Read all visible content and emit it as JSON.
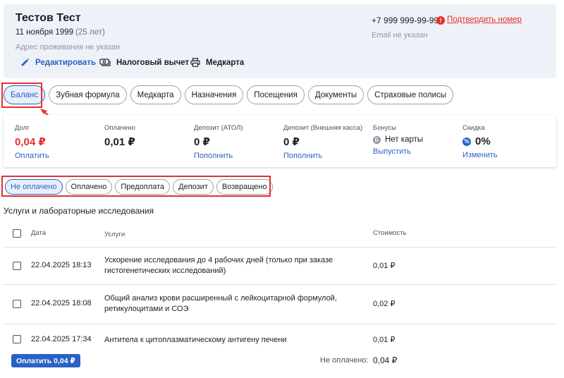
{
  "patient": {
    "name": "Тестов Тест",
    "birth_date": "11 ноября 1999",
    "age": "(25 лет)",
    "address": "Адрес проживания не указан",
    "phone": "+7 999 999-99-99",
    "confirm_link": "Подтвердить номер",
    "email": "Email не указан"
  },
  "actions": [
    {
      "label": "Редактировать",
      "icon": "pencil-icon"
    },
    {
      "label": "Налоговый вычет",
      "icon": "money-icon"
    },
    {
      "label": "Медкарта",
      "icon": "printer-icon"
    }
  ],
  "tabs": [
    "Баланс",
    "Зубная формула",
    "Медкарта",
    "Назначения",
    "Посещения",
    "Документы",
    "Страховые полисы"
  ],
  "active_tab": "Баланс",
  "balance": {
    "debt": {
      "label": "Долг",
      "value": "0,04 ₽",
      "link": "Оплатить"
    },
    "paid": {
      "label": "Оплачено",
      "value": "0,01 ₽"
    },
    "deposit_atol": {
      "label": "Депозит (АТОЛ)",
      "value": "0 ₽",
      "link": "Пополнить"
    },
    "deposit_external": {
      "label": "Депозит (Внешняя касса)",
      "value": "0 ₽",
      "link": "Пополнить"
    },
    "bonuses": {
      "label": "Бонусы",
      "value": "Нет карты",
      "icon_glyph": "Б",
      "link": "Выпустить"
    },
    "discount": {
      "label": "Скидка",
      "value": "0%",
      "icon_glyph": "%",
      "link": "Изменить"
    }
  },
  "filters": [
    "Не оплачено",
    "Оплачено",
    "Предоплата",
    "Депозит",
    "Возвращено"
  ],
  "active_filter": "Не оплачено",
  "section_title": "Услуги и лабораторные исследования",
  "table": {
    "headers": {
      "date": "Дата",
      "service": "Услуги",
      "cost": "Стоимость"
    },
    "rows": [
      {
        "date": "22.04.2025 18:13",
        "service": "Ускорение исследования до 4 рабочих дней (только при заказе гистогенетических исследований)",
        "cost": "0,01 ₽"
      },
      {
        "date": "22.04.2025 18:08",
        "service": "Общий анализ крови расширенный с лейкоцитарной формулой, ретикулоцитами и СОЭ",
        "cost": "0,02 ₽"
      },
      {
        "date": "22.04.2025 17:34",
        "service": "Антитела к цитоплазматическому антигену печени",
        "cost": "0,01 ₽"
      }
    ]
  },
  "footer": {
    "pay_button": "Оплатить 0,04 ₽",
    "unpaid_label": "Не оплачено:",
    "unpaid_value": "0,04 ₽"
  },
  "colors": {
    "accent": "#2962c4",
    "danger": "#e5302d",
    "header_bg": "#eef2f8"
  }
}
